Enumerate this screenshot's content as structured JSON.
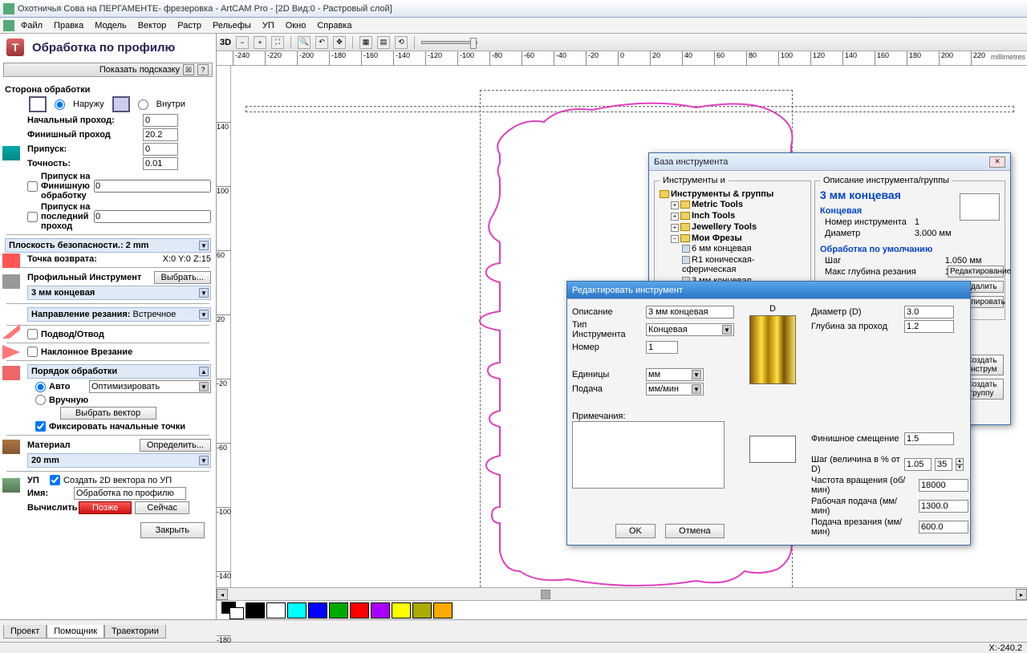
{
  "title": "Охотничья Сова на ПЕРГАМЕНТЕ- фрезеровка - ArtCAM Pro - [2D Вид:0 - Растровый слой]",
  "menu": [
    "Файл",
    "Правка",
    "Модель",
    "Вектор",
    "Растр",
    "Рельефы",
    "УП",
    "Окно",
    "Справка"
  ],
  "panel": {
    "title": "Обработка по профилю",
    "hint": "Показать подсказку",
    "side_title": "Сторона обработки",
    "outside": "Наружу",
    "inside": "Внутри",
    "start_pass": "Начальный проход:",
    "start_pass_v": "0",
    "finish_pass": "Финишный проход",
    "finish_pass_v": "20.2",
    "allowance": "Припуск:",
    "allowance_v": "0",
    "tolerance": "Точность:",
    "tolerance_v": "0.01",
    "finish_allow_chk": "Припуск на Финишную обработку",
    "finish_allow_v": "0",
    "last_pass_chk": "Припуск на последний проход",
    "last_pass_v": "0",
    "safe_z": "Плоскость безопасности.: 2 mm",
    "home": "Точка возврата:",
    "home_v": "X:0 Y:0 Z:15",
    "profile_tool": "Профильный Инструмент",
    "select_btn": "Выбрать...",
    "tool_name": "3 мм концевая",
    "cut_dir": "Направление резания:",
    "cut_dir_v": "Встречное",
    "lead": "Подвод/Отвод",
    "ramp": "Наклонное Врезание",
    "order": "Порядок обработки",
    "auto": "Авто",
    "manual": "Вручную",
    "optimize": "Оптимизировать",
    "select_vector": "Выбрать вектор",
    "fix_start": "Фиксировать начальные точки",
    "material": "Материал",
    "material_v": "20 mm",
    "define": "Определить...",
    "toolpath": "УП",
    "create2d": "Создать 2D вектора по УП",
    "name_lbl": "Имя:",
    "name_v": "Обработка по профилю",
    "calc": "Вычислить",
    "later": "Позже",
    "now": "Сейчас",
    "close": "Закрыть"
  },
  "tabs": [
    "Проект",
    "Помощник",
    "Траектории"
  ],
  "canvas_toolbar": {
    "btn3d": "3D"
  },
  "ruler_unit": "millimetres",
  "ticks_h": [
    -220,
    -180,
    -140,
    -100,
    -60,
    -20,
    20,
    60,
    100,
    140,
    180,
    220
  ],
  "ticks_h_minor": [
    -240,
    -200,
    -160,
    -120,
    -80,
    -40,
    0,
    40,
    80,
    120,
    160,
    200
  ],
  "ticks_v": [
    -180,
    -140,
    -100,
    -60,
    -20,
    20,
    60,
    100,
    140
  ],
  "swatch_colors": [
    "#000000",
    "#ffffff",
    "#00ffff",
    "#0000ff",
    "#00aa00",
    "#ff0000",
    "#aa00ff",
    "#ffff00",
    "#aaaa00",
    "#ffaa00"
  ],
  "dlg_tooldb": {
    "title": "База инструмента",
    "groups_title": "Инструменты и",
    "desc_title": "Описание инструмента/группы",
    "tree": {
      "root": "Инструменты & группы",
      "g1": "Metric Tools",
      "g2": "Inch Tools",
      "g3": "Jewellery Tools",
      "g4": "Мои Фрезы",
      "t1": "6 мм концевая",
      "t2": "R1 коническая-сферическая",
      "t3": "3 мм концевая"
    },
    "tool_title": "3 мм концевая",
    "type": "Концевая",
    "num_lbl": "Номер инструмента",
    "num_v": "1",
    "dia_lbl": "Диаметр",
    "dia_v": "3.000 мм",
    "mach_title": "Обработка по умолчанию",
    "step_lbl": "Шаг",
    "step_v": "1.050 мм",
    "depth_lbl": "Макс глубина резания",
    "depth_v": "1.200 мм",
    "btn_edit": "Редактирование",
    "btn_del": "Удалить",
    "btn_copy": "Копировать",
    "btn_create_tool": "Создать инструм",
    "btn_create_group": "Создать группу"
  },
  "dlg_edit": {
    "title": "Редактировать инструмент",
    "desc_lbl": "Описание",
    "desc_v": "3 мм концевая",
    "type_lbl": "Тип Инструмента",
    "type_v": "Концевая",
    "num_lbl": "Номер",
    "num_v": "1",
    "unit_lbl": "Единицы",
    "unit_v": "мм",
    "feed_lbl": "Подача",
    "feed_v": "мм/мин",
    "notes_lbl": "Примечания:",
    "d_lbl": "D",
    "dia_lbl": "Диаметр (D)",
    "dia_v": "3.0",
    "stepdown_lbl": "Глубина за проход",
    "stepdown_v": "1.2",
    "finish_off_lbl": "Финишное смещение",
    "finish_off_v": "1.5",
    "step_lbl": "Шаг (величина в % от D)",
    "step_a": "1.05",
    "step_b": "35",
    "spindle_lbl": "Частота вращения (об/мин)",
    "spindle_v": "18000",
    "feedrate_lbl": "Рабочая подача (мм/мин)",
    "feedrate_v": "1300.0",
    "plunge_lbl": "Подача врезания (мм/мин)",
    "plunge_v": "600.0",
    "ok": "OK",
    "cancel": "Отмена"
  },
  "status": "X:-240.2"
}
